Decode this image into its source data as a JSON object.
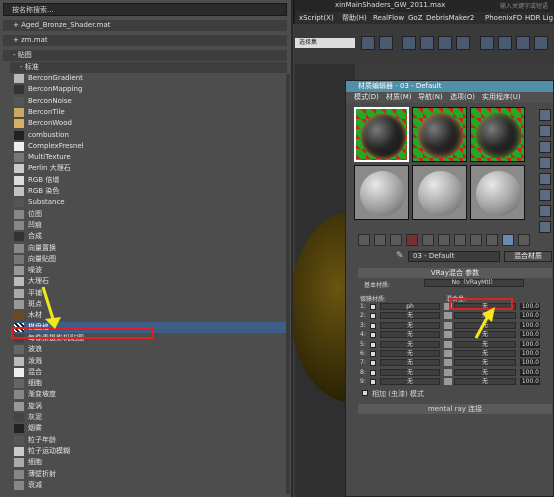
{
  "app": {
    "title_fragment": "xinMainShaders_GW_2011.max",
    "search_hint": "输入关键字或短语",
    "menu": [
      "xScript(X)",
      "帮助(H)",
      "RealFlow",
      "GoZ",
      "DebrisMaker2",
      "PhoenixFD",
      "HDR Lig"
    ],
    "toolbar_dropdown": "选择集"
  },
  "browser": {
    "search_placeholder": "按名称搜索...",
    "rollouts": [
      "+ Aged_Bronze_Shader.mat",
      "+ zm.mat",
      "- 贴图",
      "- 标准"
    ],
    "items": [
      "BerconGradient",
      "BerconMapping",
      "BerconNoise",
      "BerconTile",
      "BerconWood",
      "combustion",
      "ComplexFresnel",
      "MultiTexture",
      "Perlin 大理石",
      "RGB 倍增",
      "RGB 染色",
      "Substance",
      "位图",
      "凹痕",
      "合成",
      "向量置换",
      "向量贴图",
      "噪波",
      "大理石",
      "平铺",
      "斑点",
      "木材",
      "棋盘格",
      "法线凹凸",
      "粒子年龄",
      "泼溅",
      "混合",
      "漩涡",
      "每像素摄影机贴图",
      "灰泥",
      "烟雾",
      "粒子运动模糊",
      "细胞",
      "渐变坡度",
      "渐变",
      "衰减",
      "输出",
      "遮罩"
    ],
    "visible_items": [
      "BerconGradient",
      "BerconMapping",
      "BerconNoise",
      "BerconTile",
      "BerconWood",
      "combustion",
      "ComplexFresnel",
      "MultiTexture",
      "Perlin 大理石",
      "RGB 倍增",
      "RGB 染色",
      "Substance",
      "位图",
      "凹痕",
      "合成",
      "向量置换",
      "向量贴图",
      "噪波",
      "大理石",
      "平铺",
      "斑点",
      "木材",
      "棋盘格",
      "每像素摄影机贴图",
      "波浪",
      "泼溅",
      "混合",
      "细胞",
      "渐变坡度",
      "旋涡",
      "灰泥",
      "烟雾",
      "粒子年龄",
      "粒子运动模糊",
      "细胞",
      "薄壁折射",
      "衰减"
    ],
    "selected_item": "棋盘格"
  },
  "material_editor": {
    "title": "材质编辑器 - 03 - Default",
    "menu": [
      "模式(D)",
      "材质(M)",
      "导航(N)",
      "选项(O)",
      "实用程序(U)"
    ],
    "material_name": "03 - Default",
    "material_type": "混合材质",
    "rollout_title": "VRay混合 参数",
    "base_label": "基本材质:",
    "base_value": "No（VRayMtl）",
    "coat_label": "镀膜材质:",
    "blend_label": "混合量:",
    "coat_first": "ph",
    "none_label": "无",
    "layer_numbers": [
      "1:",
      "2:",
      "3:",
      "4:",
      "5:",
      "6:",
      "7:",
      "8:",
      "9:"
    ],
    "amount_value": "100.0",
    "additive_label": "相加 (虫漆) 模式",
    "mentalray_label": "mental ray 连接"
  },
  "colors": {
    "selection": "#3d5c86",
    "annotation_red": "#e02020",
    "annotation_arrow": "#f4e61c",
    "title_blue": "#4f8fa8"
  }
}
